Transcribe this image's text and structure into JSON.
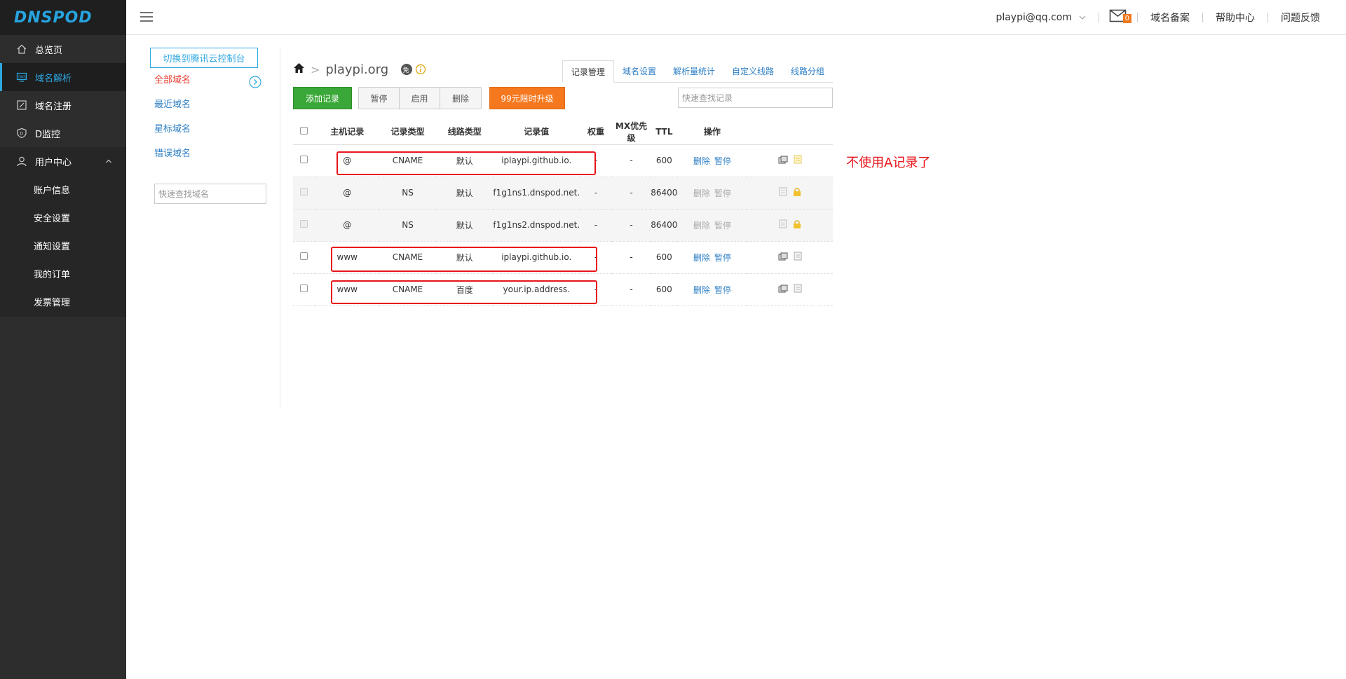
{
  "brand": {
    "logo": "DNSPOD",
    "accent": "#26a4e0"
  },
  "sidebar": {
    "items": [
      {
        "label": "总览页",
        "icon": "home-icon"
      },
      {
        "label": "域名解析",
        "icon": "monitor-icon",
        "active": true
      },
      {
        "label": "域名注册",
        "icon": "edit-icon"
      },
      {
        "label": "D监控",
        "icon": "shield-icon"
      },
      {
        "label": "用户中心",
        "icon": "user-icon",
        "expanded": true
      }
    ],
    "sub_items": [
      "账户信息",
      "安全设置",
      "通知设置",
      "我的订单",
      "发票管理"
    ]
  },
  "topbar": {
    "user": "playpi@qq.com",
    "mail_count": "0",
    "links": [
      "域名备案",
      "帮助中心",
      "问题反馈"
    ]
  },
  "domain_panel": {
    "switch_label": "切换到腾讯云控制台",
    "links": [
      "全部域名",
      "最近域名",
      "星标域名",
      "错误域名"
    ],
    "search_placeholder": "快速查找域名"
  },
  "main": {
    "domain": "playpi.org",
    "free_badge": "免",
    "tabs": [
      "记录管理",
      "域名设置",
      "解析量统计",
      "自定义线路",
      "线路分组"
    ],
    "active_tab": 0,
    "toolbar": {
      "add": "添加记录",
      "pause": "暂停",
      "enable": "启用",
      "delete": "删除",
      "upgrade": "99元限时升级",
      "search_placeholder": "快速查找记录"
    },
    "columns": [
      "主机记录",
      "记录类型",
      "线路类型",
      "记录值",
      "权重",
      "MX优先级",
      "TTL",
      "操作"
    ],
    "rows": [
      {
        "host": "@",
        "type": "CNAME",
        "line": "默认",
        "value": "iplaypi.github.io.",
        "weight": "-",
        "mx": "-",
        "ttl": "600",
        "op1": "删除",
        "op2": "暂停"
      },
      {
        "host": "@",
        "type": "NS",
        "line": "默认",
        "value": "f1g1ns1.dnspod.net.",
        "weight": "-",
        "mx": "-",
        "ttl": "86400",
        "op1": "删除",
        "op2": "暂停"
      },
      {
        "host": "@",
        "type": "NS",
        "line": "默认",
        "value": "f1g1ns2.dnspod.net.",
        "weight": "-",
        "mx": "-",
        "ttl": "86400",
        "op1": "删除",
        "op2": "暂停"
      },
      {
        "host": "www",
        "type": "CNAME",
        "line": "默认",
        "value": "iplaypi.github.io.",
        "weight": "-",
        "mx": "-",
        "ttl": "600",
        "op1": "删除",
        "op2": "暂停"
      },
      {
        "host": "www",
        "type": "CNAME",
        "line": "百度",
        "value": "your.ip.address.",
        "weight": "-",
        "mx": "-",
        "ttl": "600",
        "op1": "删除",
        "op2": "暂停"
      }
    ]
  },
  "annotation": {
    "text": "不使用A记录了",
    "color": "#e8151b"
  }
}
